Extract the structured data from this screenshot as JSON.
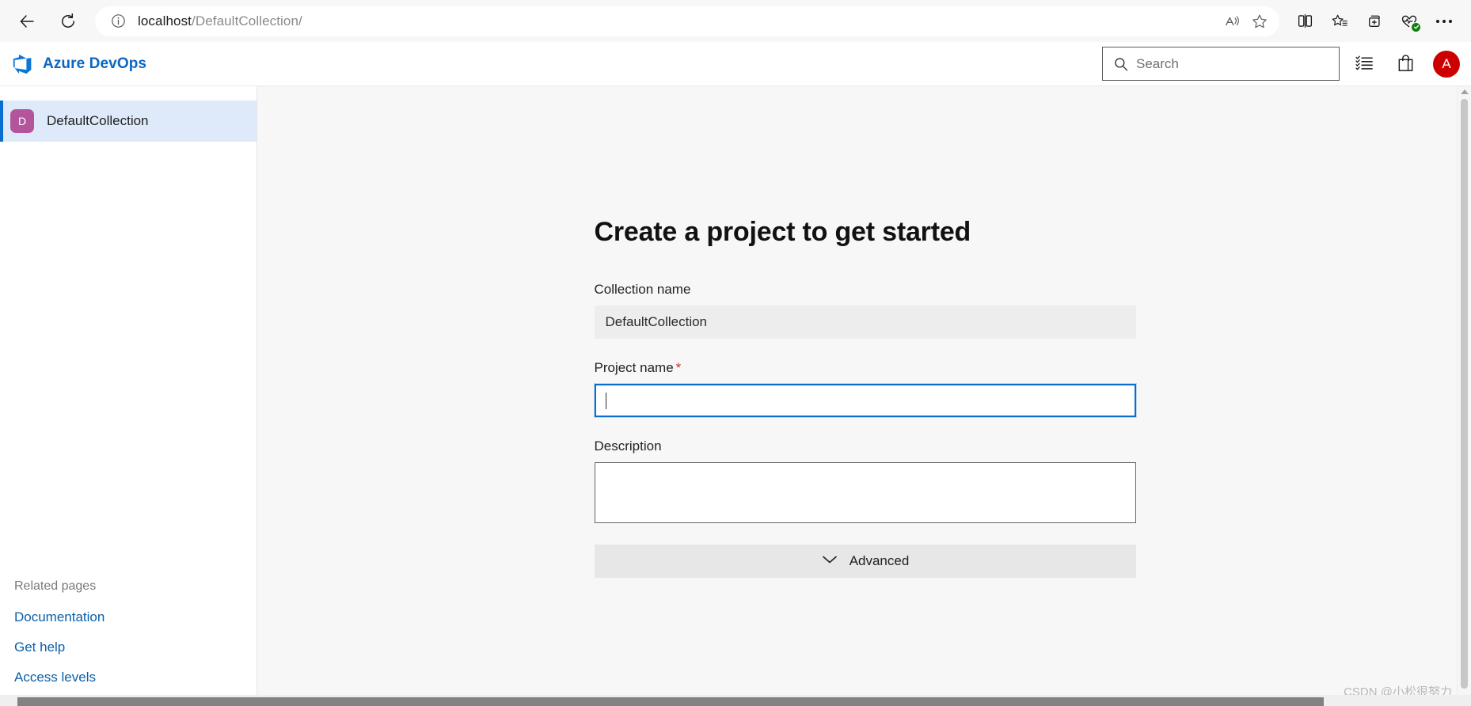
{
  "browser": {
    "back_title": "Back",
    "refresh_title": "Refresh",
    "url_host": "localhost",
    "url_path": "/DefaultCollection/",
    "site_info_title": "View site information",
    "icons": {
      "read_aloud": "read-aloud-icon",
      "favorite": "favorite-star-icon",
      "split_screen": "split-screen-icon",
      "favorites_list": "favorites-list-icon",
      "collections": "collections-icon",
      "browser_essentials": "browser-essentials-icon",
      "settings_more": "settings-and-more-icon"
    }
  },
  "header": {
    "product_name": "Azure DevOps",
    "brand_color": "#0b67c2",
    "logo_icon": "azure-devops-logo-icon",
    "search": {
      "placeholder": "Search",
      "value": "",
      "icon": "search-icon"
    },
    "actions": [
      {
        "name": "my-work-icon",
        "label": "My work items"
      },
      {
        "name": "marketplace-icon",
        "label": "Marketplace"
      }
    ],
    "avatar": {
      "initial": "A",
      "color": "#cc0000"
    }
  },
  "sidebar": {
    "collection": {
      "initial": "D",
      "label": "DefaultCollection",
      "avatar_color": "#b4559b",
      "selected_bg": "#deeafa",
      "accent_color": "#0a6ed1",
      "selected": true
    },
    "related": {
      "title": "Related pages",
      "links": [
        {
          "label": "Documentation"
        },
        {
          "label": "Get help"
        },
        {
          "label": "Access levels"
        }
      ],
      "link_color": "#0a5fa8"
    }
  },
  "main": {
    "title": "Create a project to get started",
    "fields": {
      "collection_name": {
        "label": "Collection name",
        "value": "DefaultCollection",
        "readonly": true
      },
      "project_name": {
        "label": "Project name",
        "required_marker": "*",
        "value": "",
        "placeholder": "",
        "focused": true
      },
      "description": {
        "label": "Description",
        "value": "",
        "placeholder": ""
      }
    },
    "advanced": {
      "label": "Advanced",
      "icon": "chevron-down-icon",
      "expanded": false
    }
  },
  "watermark": {
    "text": "CSDN @小松很努力"
  }
}
